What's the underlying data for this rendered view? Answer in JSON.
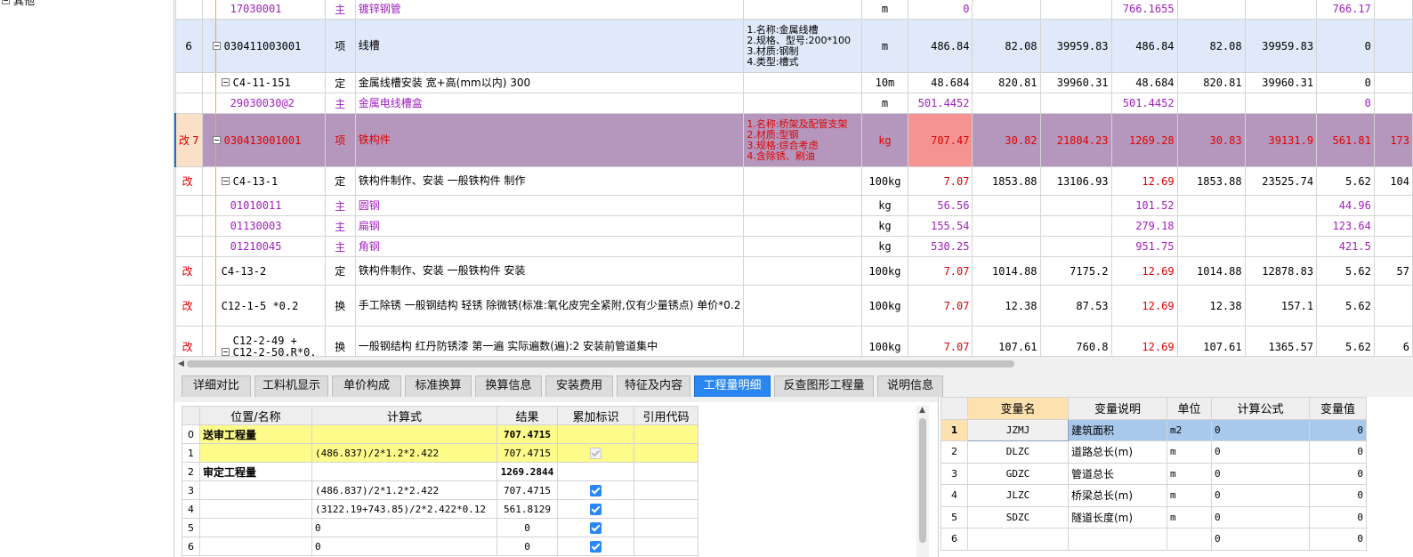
{
  "left_tree": {
    "top_item_label": "其他"
  },
  "main_rows": [
    {
      "seq": "",
      "flag": "",
      "code": "17030001",
      "type": "主",
      "name": "镀锌钢管",
      "desc": "",
      "unit": "m",
      "c1": "0",
      "c2": "",
      "c3": "",
      "c4": "766.1655",
      "c5": "",
      "c6": "",
      "c7": "766.17",
      "c8": ""
    },
    {
      "seq": "6",
      "flag": "",
      "code": "030411003001",
      "type": "项",
      "name": "线槽",
      "desc": "1.名称:金属线槽\n2.规格、型号:200*100\n3.材质:钢制\n4.类型:槽式",
      "unit": "m",
      "c1": "486.84",
      "c2": "82.08",
      "c3": "39959.83",
      "c4": "486.84",
      "c5": "82.08",
      "c6": "39959.83",
      "c7": "0",
      "c8": ""
    },
    {
      "seq": "",
      "flag": "",
      "code": "C4-11-151",
      "type": "定",
      "name": "金属线槽安装 宽+高(mm以内) 300",
      "desc": "",
      "unit": "10m",
      "c1": "48.684",
      "c2": "820.81",
      "c3": "39960.31",
      "c4": "48.684",
      "c5": "820.81",
      "c6": "39960.31",
      "c7": "0",
      "c8": ""
    },
    {
      "seq": "",
      "flag": "",
      "code": "29030030@2",
      "type": "主",
      "name": "金属电线槽盒",
      "desc": "",
      "unit": "m",
      "c1": "501.4452",
      "c2": "",
      "c3": "",
      "c4": "501.4452",
      "c5": "",
      "c6": "",
      "c7": "0",
      "c8": ""
    },
    {
      "seq": "7",
      "flag": "改",
      "code": "030413001001",
      "type": "项",
      "name": "铁构件",
      "desc": "1.名称:桥架及配管支架\n2.材质:型钢\n3.规格:综合考虑\n4.含除锈、刷油",
      "unit": "kg",
      "c1": "707.47",
      "c2": "30.82",
      "c3": "21804.23",
      "c4": "1269.28",
      "c5": "30.83",
      "c6": "39131.9",
      "c7": "561.81",
      "c8": "173"
    },
    {
      "seq": "",
      "flag": "改",
      "code": "C4-13-1",
      "type": "定",
      "name": "铁构件制作、安装 一般铁构件 制作",
      "desc": "",
      "unit": "100kg",
      "c1": "7.07",
      "c2": "1853.88",
      "c3": "13106.93",
      "c4": "12.69",
      "c5": "1853.88",
      "c6": "23525.74",
      "c7": "5.62",
      "c8": "104"
    },
    {
      "seq": "",
      "flag": "",
      "code": "01010011",
      "type": "主",
      "name": "圆钢",
      "desc": "",
      "unit": "kg",
      "c1": "56.56",
      "c2": "",
      "c3": "",
      "c4": "101.52",
      "c5": "",
      "c6": "",
      "c7": "44.96",
      "c8": ""
    },
    {
      "seq": "",
      "flag": "",
      "code": "01130003",
      "type": "主",
      "name": "扁钢",
      "desc": "",
      "unit": "kg",
      "c1": "155.54",
      "c2": "",
      "c3": "",
      "c4": "279.18",
      "c5": "",
      "c6": "",
      "c7": "123.64",
      "c8": ""
    },
    {
      "seq": "",
      "flag": "",
      "code": "01210045",
      "type": "主",
      "name": "角钢",
      "desc": "",
      "unit": "kg",
      "c1": "530.25",
      "c2": "",
      "c3": "",
      "c4": "951.75",
      "c5": "",
      "c6": "",
      "c7": "421.5",
      "c8": ""
    },
    {
      "seq": "",
      "flag": "改",
      "code": "C4-13-2",
      "type": "定",
      "name": "铁构件制作、安装 一般铁构件 安装",
      "desc": "",
      "unit": "100kg",
      "c1": "7.07",
      "c2": "1014.88",
      "c3": "7175.2",
      "c4": "12.69",
      "c5": "1014.88",
      "c6": "12878.83",
      "c7": "5.62",
      "c8": "57"
    },
    {
      "seq": "",
      "flag": "改",
      "code": "C12-1-5 *0.2",
      "type": "换",
      "name": "手工除锈 一般钢结构 轻锈 除微锈(标准:氧化皮完全紧附,仅有少量锈点) 单价*0.2",
      "desc": "",
      "unit": "100kg",
      "c1": "7.07",
      "c2": "12.38",
      "c3": "87.53",
      "c4": "12.69",
      "c5": "12.38",
      "c6": "157.1",
      "c7": "5.62",
      "c8": ""
    },
    {
      "seq": "",
      "flag": "改",
      "code": "C12-2-49 + C12-2-50,R*0.",
      "type": "换",
      "name": "一般钢结构 红丹防锈漆 第一遍 实际遍数(遍):2 安装前管道集中",
      "desc": "",
      "unit": "100kg",
      "c1": "7.07",
      "c2": "107.61",
      "c3": "760.8",
      "c4": "12.69",
      "c5": "107.61",
      "c6": "1365.57",
      "c7": "5.62",
      "c8": "6"
    }
  ],
  "tabs": [
    "详细对比",
    "工料机显示",
    "单价构成",
    "标准换算",
    "换算信息",
    "安装费用",
    "特征及内容",
    "工程量明细",
    "反查图形工程量",
    "说明信息"
  ],
  "active_tab": "工程量明细",
  "qty_table": {
    "headers": [
      "位置/名称",
      "计算式",
      "结果",
      "累加标识",
      "引用代码"
    ],
    "rows": [
      {
        "idx": "0",
        "name": "送审工程量",
        "formula": "",
        "result": "707.4715",
        "check": "none"
      },
      {
        "idx": "1",
        "name": "",
        "formula": "(486.837)/2*1.2*2.422",
        "result": "707.4715",
        "check": "disabled"
      },
      {
        "idx": "2",
        "name": "审定工程量",
        "formula": "",
        "result": "1269.2844",
        "check": "none"
      },
      {
        "idx": "3",
        "name": "",
        "formula": "(486.837)/2*1.2*2.422",
        "result": "707.4715",
        "check": "checked"
      },
      {
        "idx": "4",
        "name": "",
        "formula": "(3122.19+743.85)/2*2.422*0.12",
        "result": "561.8129",
        "check": "checked"
      },
      {
        "idx": "5",
        "name": "",
        "formula": "0",
        "result": "0",
        "check": "checked"
      },
      {
        "idx": "6",
        "name": "",
        "formula": "0",
        "result": "0",
        "check": "checked"
      }
    ]
  },
  "var_table": {
    "headers": [
      "变量名",
      "变量说明",
      "单位",
      "计算公式",
      "变量值"
    ],
    "rows": [
      {
        "idx": "1",
        "name": "JZMJ",
        "desc": "建筑面积",
        "unit": "m2",
        "formula": "0",
        "value": "0"
      },
      {
        "idx": "2",
        "name": "DLZC",
        "desc": "道路总长(m)",
        "unit": "m",
        "formula": "0",
        "value": "0"
      },
      {
        "idx": "3",
        "name": "GDZC",
        "desc": "管道总长",
        "unit": "m",
        "formula": "0",
        "value": "0"
      },
      {
        "idx": "4",
        "name": "JLZC",
        "desc": "桥梁总长(m)",
        "unit": "m",
        "formula": "0",
        "value": "0"
      },
      {
        "idx": "5",
        "name": "SDZC",
        "desc": "隧道长度(m)",
        "unit": "m",
        "formula": "0",
        "value": "0"
      },
      {
        "idx": "6",
        "name": "",
        "desc": "",
        "unit": "",
        "formula": "0",
        "value": "0"
      }
    ]
  },
  "colors": {
    "tab_active": "#2a86f0",
    "selected_row": "#b597bd",
    "highlight_cell": "#f59393",
    "modified_text": "#e00000",
    "material_text": "#a020c0",
    "yellow_row": "#fdfb8a"
  }
}
